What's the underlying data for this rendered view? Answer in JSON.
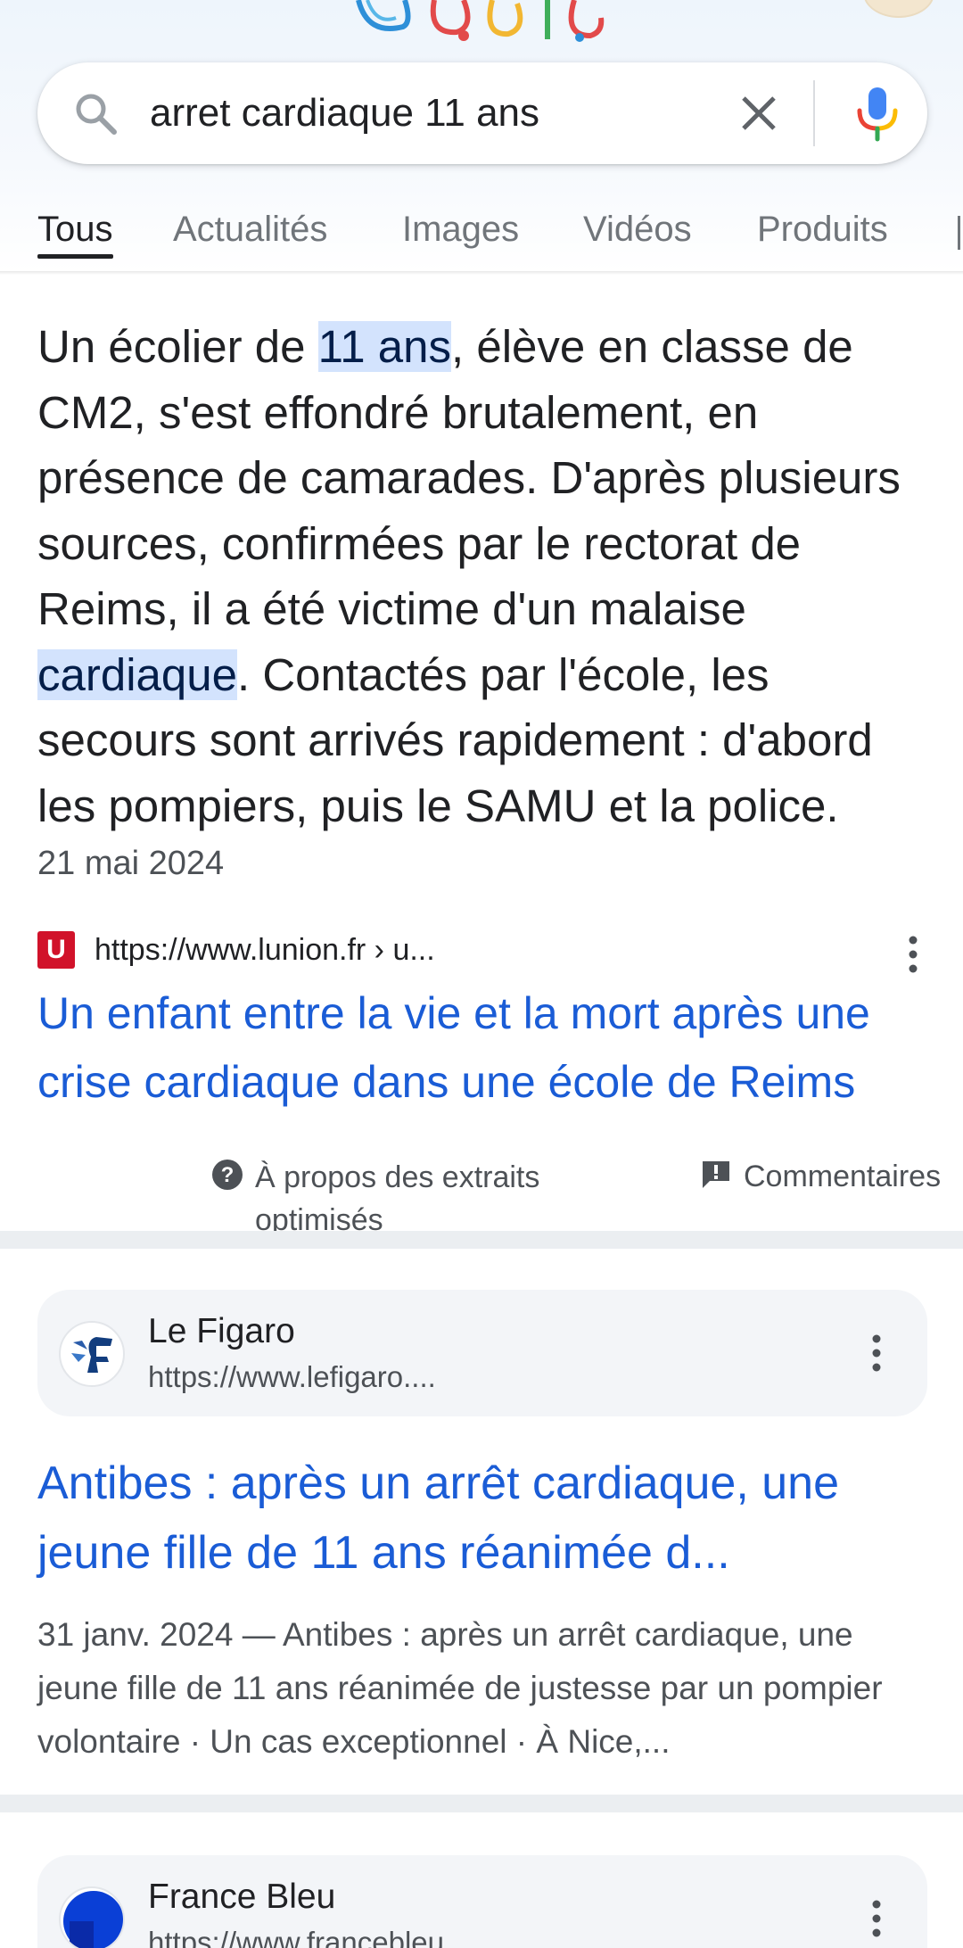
{
  "search": {
    "query": "arret cardiaque 11 ans"
  },
  "tabs": [
    {
      "label": "Tous",
      "active": true
    },
    {
      "label": "Actualités",
      "active": false
    },
    {
      "label": "Images",
      "active": false
    },
    {
      "label": "Vidéos",
      "active": false
    },
    {
      "label": "Produits",
      "active": false
    }
  ],
  "featured_snippet": {
    "text_parts": [
      {
        "text": "Un écolier de ",
        "highlight": false
      },
      {
        "text": "11 ans",
        "highlight": true
      },
      {
        "text": ", élève en classe de CM2, s'est effondré brutalement, en présence de camarades. D'après plusieurs sources, confirmées par le rectorat de Reims, il a été victime d'un malaise ",
        "highlight": false
      },
      {
        "text": "cardiaque",
        "highlight": true
      },
      {
        "text": ". Contactés par l'école, les secours sont arrivés rapidement : d'abord les pompiers, puis le SAMU et la police.",
        "highlight": false
      }
    ],
    "date": "21 mai 2024",
    "source_favicon_letter": "U",
    "source_url": "https://www.lunion.fr › u...",
    "title": "Un enfant entre la vie et la mort après une crise cardiaque dans une école de Reims",
    "about_label": "À propos des extraits optimisés",
    "feedback_label": "Commentaires"
  },
  "results": [
    {
      "site_name": "Le Figaro",
      "site_url": "https://www.lefigaro....",
      "title": "Antibes : après un arrêt cardiaque, une jeune fille de 11 ans réanimée d...",
      "snippet": "31 janv. 2024 — Antibes : après un arrêt cardiaque, une jeune fille de 11 ans réanimée de justesse par un pompier volontaire · Un cas exceptionnel · À Nice,..."
    },
    {
      "site_name": "France Bleu",
      "site_url": "https://www.francebleu..."
    }
  ],
  "colors": {
    "link": "#1a5cd6",
    "highlight_bg": "#d3e3fd",
    "separator": "#ebeef1",
    "lunion_red": "#d1122a"
  }
}
